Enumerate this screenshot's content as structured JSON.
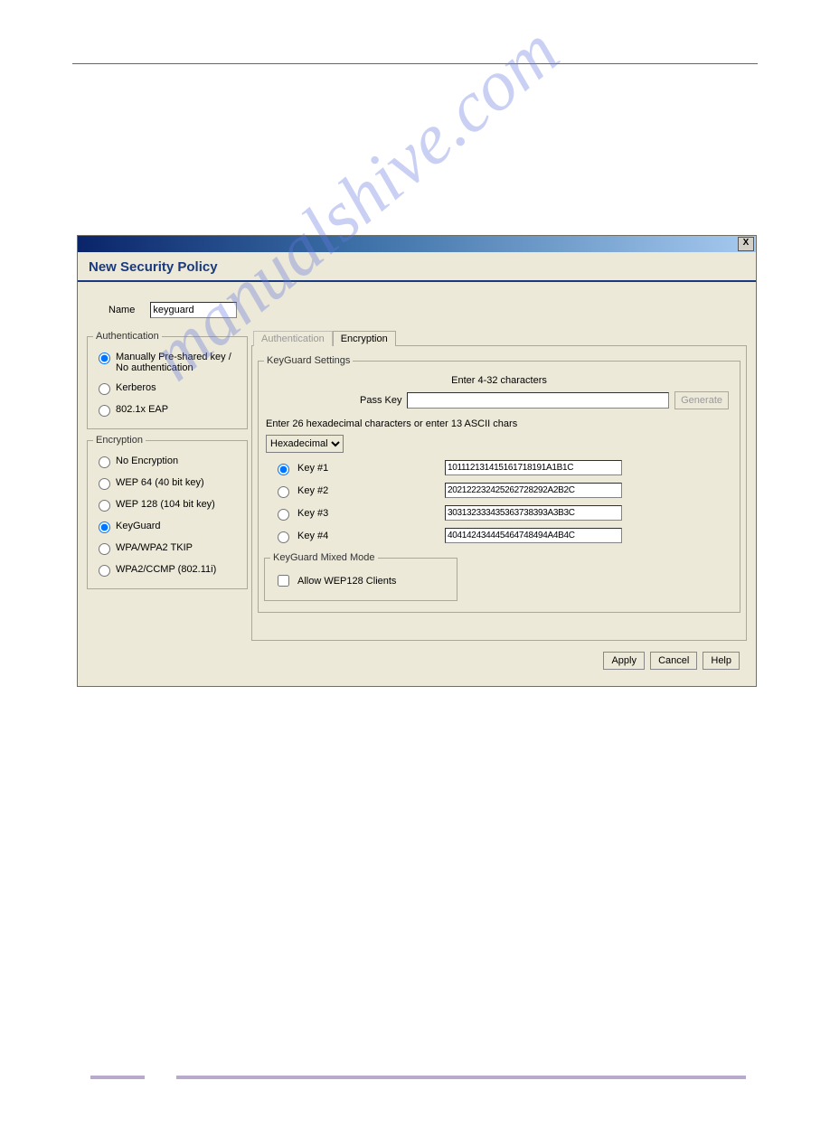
{
  "dialog": {
    "title": "New Security Policy",
    "name_label": "Name",
    "name_value": "keyguard"
  },
  "authentication": {
    "legend": "Authentication",
    "options": {
      "preshared": "Manually Pre-shared key / No authentication",
      "kerberos": "Kerberos",
      "eap": "802.1x EAP"
    },
    "selected": "preshared"
  },
  "encryption": {
    "legend": "Encryption",
    "options": {
      "none": "No Encryption",
      "wep64": "WEP 64 (40 bit key)",
      "wep128": "WEP 128 (104 bit key)",
      "keyguard": "KeyGuard",
      "wpa_tkip": "WPA/WPA2 TKIP",
      "wpa2_ccmp": "WPA2/CCMP (802.11i)"
    },
    "selected": "keyguard"
  },
  "tabs": {
    "auth_tab": "Authentication",
    "enc_tab": "Encryption"
  },
  "keyguard": {
    "legend": "KeyGuard Settings",
    "instruction": "Enter 4-32 characters",
    "passkey_label": "Pass Key",
    "passkey_value": "",
    "generate_label": "Generate",
    "hex_note": "Enter 26 hexadecimal characters or enter 13 ASCII chars",
    "format_options": [
      "Hexadecimal"
    ],
    "format_selected": "Hexadecimal",
    "keys": {
      "k1_label": "Key #1",
      "k1_value": "101112131415161718191A1B1C",
      "k2_label": "Key #2",
      "k2_value": "202122232425262728292A2B2C",
      "k3_label": "Key #3",
      "k3_value": "303132333435363738393A3B3C",
      "k4_label": "Key #4",
      "k4_value": "404142434445464748494A4B4C"
    },
    "selected_key": "k1",
    "mixed_legend": "KeyGuard Mixed Mode",
    "allow_wep128_label": "Allow WEP128 Clients",
    "allow_wep128_checked": false
  },
  "buttons": {
    "apply": "Apply",
    "cancel": "Cancel",
    "help": "Help"
  },
  "watermark": "manualshive.com"
}
